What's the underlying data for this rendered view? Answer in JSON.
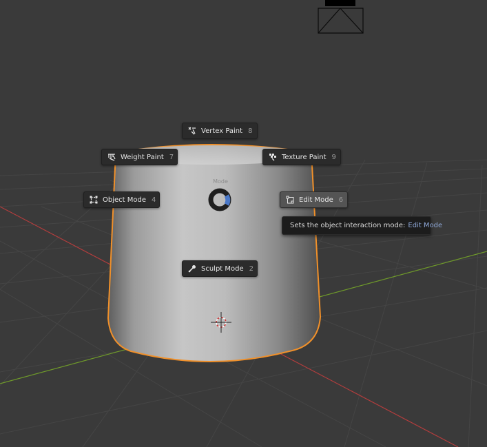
{
  "pie_menu": {
    "title": "Mode",
    "items": [
      {
        "id": "vertex-paint",
        "label": "Vertex Paint",
        "shortcut": "8",
        "icon": "vertex-paint-icon"
      },
      {
        "id": "weight-paint",
        "label": "Weight Paint",
        "shortcut": "7",
        "icon": "weight-paint-icon"
      },
      {
        "id": "texture-paint",
        "label": "Texture Paint",
        "shortcut": "9",
        "icon": "texture-paint-icon"
      },
      {
        "id": "object-mode",
        "label": "Object Mode",
        "shortcut": "4",
        "icon": "object-mode-icon"
      },
      {
        "id": "edit-mode",
        "label": "Edit Mode",
        "shortcut": "6",
        "icon": "edit-mode-icon",
        "active": true
      },
      {
        "id": "sculpt-mode",
        "label": "Sculpt Mode",
        "shortcut": "2",
        "icon": "sculpt-mode-icon"
      }
    ]
  },
  "tooltip": {
    "text": "Sets the object interaction mode:",
    "value": "Edit Mode"
  },
  "colors": {
    "background": "#3a3a3a",
    "selection_outline": "#f0902a",
    "x_axis": "#b33d3d",
    "y_axis": "#6f9a2a",
    "tooltip_highlight": "#8fa8d8",
    "pie_direction": "#4a78c8"
  }
}
